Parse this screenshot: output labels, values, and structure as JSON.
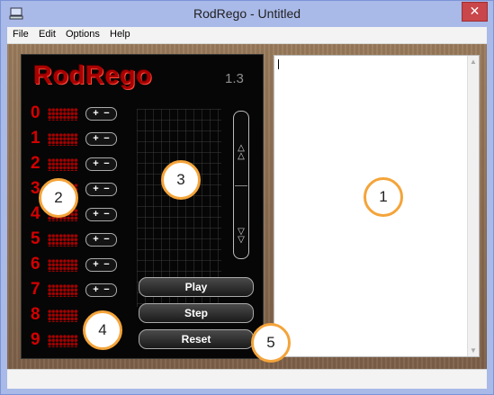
{
  "window": {
    "title": "RodRego - Untitled",
    "close": "✕"
  },
  "menu": [
    "File",
    "Edit",
    "Options",
    "Help"
  ],
  "logo": "RodRego",
  "version": "1.3",
  "registers": [
    "0",
    "1",
    "2",
    "3",
    "4",
    "5",
    "6",
    "7",
    "8",
    "9"
  ],
  "plus_minus": {
    "plus": "+",
    "minus": "−"
  },
  "controls": {
    "play": "Play",
    "step": "Step",
    "reset": "Reset"
  },
  "scroll": {
    "up": "▲",
    "down": "▼"
  },
  "callouts": [
    "1",
    "2",
    "3",
    "4",
    "5"
  ],
  "accent": "#f4a43a"
}
